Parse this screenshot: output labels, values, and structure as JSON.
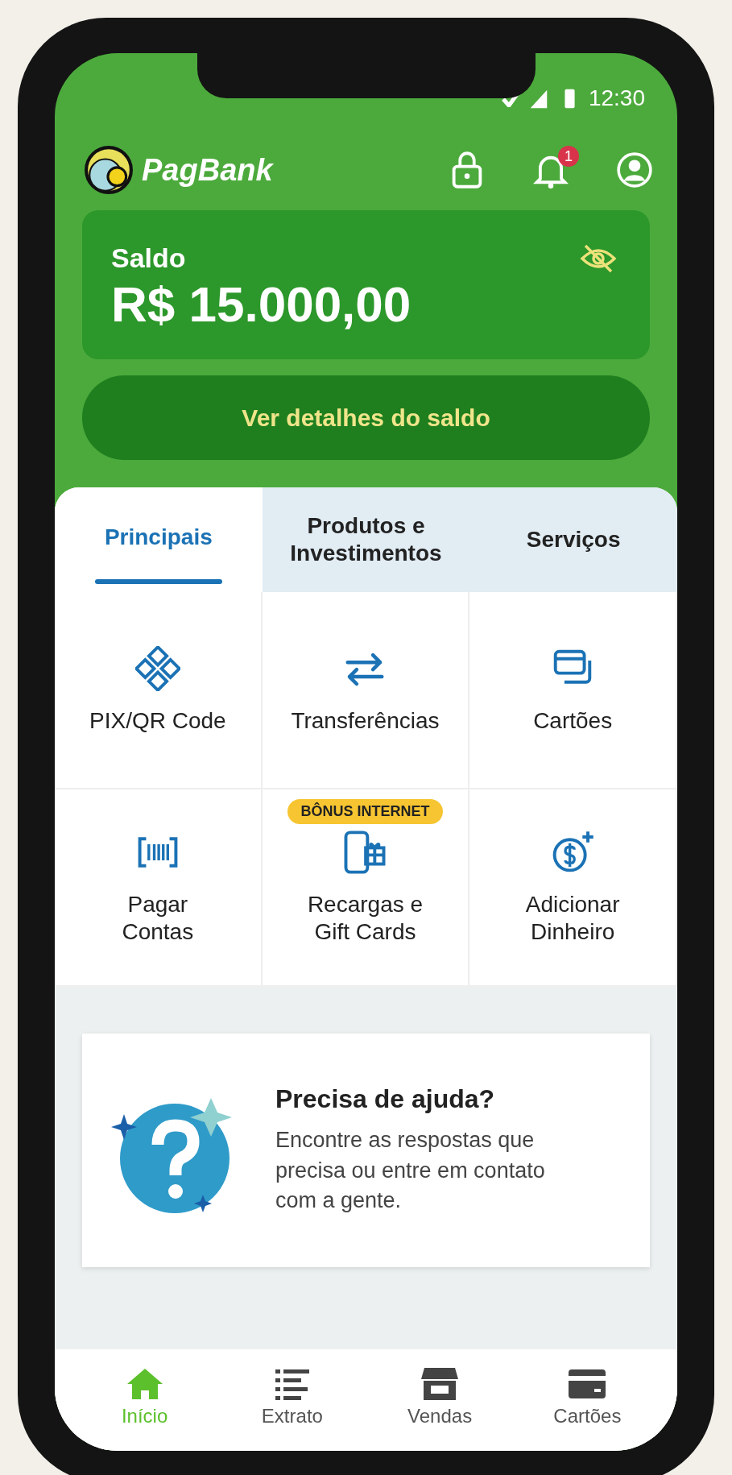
{
  "status_bar": {
    "time": "12:30"
  },
  "header": {
    "logo_text": "PagBank",
    "notification_count": "1"
  },
  "balance": {
    "label": "Saldo",
    "amount": "R$ 15.000,00"
  },
  "details_button": {
    "label": "Ver detalhes do saldo"
  },
  "tabs": [
    {
      "label": "Principais",
      "selected": true
    },
    {
      "label": "Produtos e\nInvestimentos",
      "selected": false
    },
    {
      "label": "Serviços",
      "selected": false
    }
  ],
  "shortcuts": [
    {
      "label": "PIX/QR Code",
      "kind": "pix"
    },
    {
      "label": "Transferências",
      "kind": "transfer"
    },
    {
      "label": "Cartões",
      "kind": "cards"
    },
    {
      "label": "Pagar\nContas",
      "kind": "bill"
    },
    {
      "label": "Recargas e\nGift Cards",
      "kind": "recharge",
      "badge": "BÔNUS INTERNET"
    },
    {
      "label": "Adicionar\nDinheiro",
      "kind": "deposit"
    }
  ],
  "help": {
    "title": "Precisa de ajuda?",
    "text": "Encontre as respostas que precisa ou entre em contato com a gente."
  },
  "bottom_nav": [
    {
      "label": "Início",
      "kind": "home",
      "selected": true
    },
    {
      "label": "Extrato",
      "kind": "statement",
      "selected": false
    },
    {
      "label": "Vendas",
      "kind": "sales",
      "selected": false
    },
    {
      "label": "Cartões",
      "kind": "cards",
      "selected": false
    }
  ]
}
